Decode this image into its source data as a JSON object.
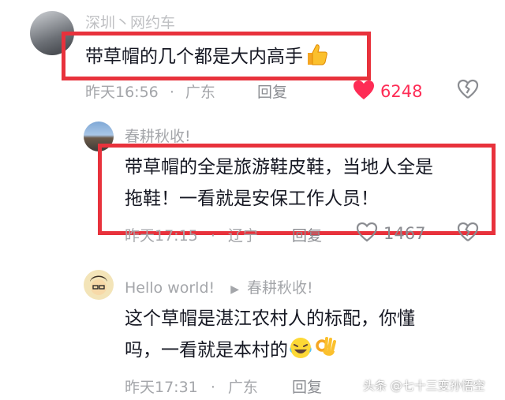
{
  "comments": [
    {
      "username": "深圳丶网约车",
      "content": "带草帽的几个都是大内高手",
      "emoji": "thumbs-up-icon",
      "date": "昨天16:56",
      "sep": "·",
      "location": "广东",
      "reply_label": "回复",
      "likes": "6248",
      "liked": true
    },
    {
      "username": "春耕秋收!",
      "content_line1": "带草帽的全是旅游鞋皮鞋，当地人全是",
      "content_line2": "拖鞋！一看就是安保工作人员！",
      "date": "昨天17:15",
      "sep": "·",
      "location": "辽宁",
      "reply_label": "回复",
      "likes": "1467",
      "liked": false
    },
    {
      "username": "Hello  world!",
      "reply_to": "春耕秋收!",
      "content_line1": "这个草帽是湛江农村人的标配，你懂",
      "content_line2": "吗，一看就是本村的",
      "emojis": [
        "laughing-crying-icon",
        "ok-hand-icon"
      ],
      "date": "昨天17:31",
      "sep": "·",
      "location": "广东",
      "reply_label": "回复"
    }
  ],
  "watermark": "头条 @七十三变孙悟空",
  "colors": {
    "highlight_border": "#e8323c",
    "like_red": "#fe2c55",
    "meta_gray": "#a4a6aa"
  }
}
